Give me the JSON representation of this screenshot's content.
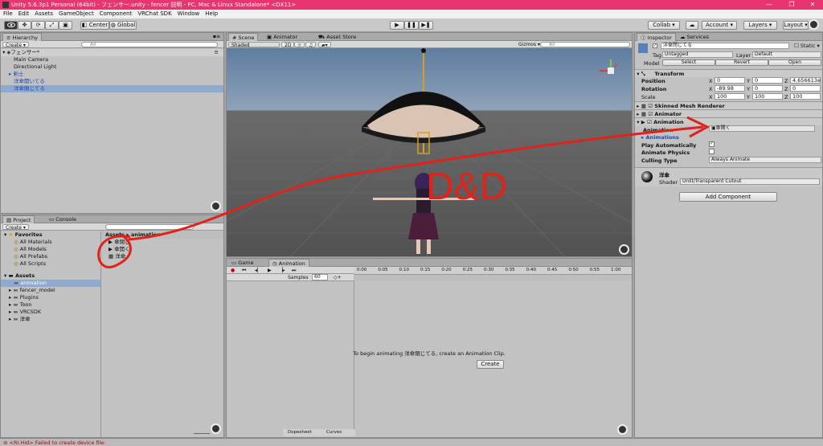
{
  "window": {
    "title": "Unity 5.6.3p1 Personal (64bit) - フェンサー.unity - fencer 説明 - PC, Mac & Linux Standalone* <DX11>",
    "controls": [
      "—",
      "❐",
      "✕"
    ]
  },
  "menu": [
    "File",
    "Edit",
    "Assets",
    "GameObject",
    "Component",
    "VRChat SDK",
    "Window",
    "Help"
  ],
  "toolbar": {
    "center": "Center",
    "global": "Global",
    "collab": "Collab ▾",
    "account": "Account ▾",
    "layers": "Layers ▾",
    "layout": "Layout ▾"
  },
  "hierarchy": {
    "tab": "Hierarchy",
    "create": "Create ▾",
    "search_placeholder": "All",
    "scene": "フェンサー*",
    "items": [
      "Main Camera",
      "Directional Light",
      "剣士",
      "洋傘開いてる",
      "洋傘閉じてる"
    ]
  },
  "scene": {
    "tabs": [
      "Scene",
      "Animator",
      "Asset Store"
    ],
    "shading": "Shaded",
    "mode2d": "2D",
    "gizmos": "Gizmos ▾",
    "search_placeholder": "All",
    "annotation": "D&D"
  },
  "project": {
    "tabs": [
      "Project",
      "Console"
    ],
    "create": "Create ▾",
    "favorites_label": "Favorites",
    "favorites": [
      "All Materials",
      "All Models",
      "All Prefabs",
      "All Scripts"
    ],
    "assets_label": "Assets",
    "assets": [
      "animation",
      "fencer_model",
      "Plugins",
      "Toon",
      "VRCSDK",
      "洋傘"
    ],
    "breadcrumb": "Assets ▸ animation",
    "files": [
      "傘閉じ",
      "傘開く",
      "洋傘"
    ]
  },
  "animation": {
    "tabs": [
      "Game",
      "Animation"
    ],
    "samples_label": "Samples",
    "samples": "60",
    "ruler": [
      "0:00",
      "0:05",
      "0:10",
      "0:15",
      "0:20",
      "0:25",
      "0:30",
      "0:35",
      "0:40",
      "0:45",
      "0:50",
      "0:55",
      "1:00"
    ],
    "message": "To begin animating 洋傘閉じてる, create an Animation Clip.",
    "create_button": "Create",
    "bottom_tabs": [
      "Dopesheet",
      "Curves"
    ]
  },
  "inspector": {
    "tabs": [
      "Inspector",
      "Services"
    ],
    "object_name": "洋傘閉じてる",
    "static": "Static ▾",
    "tag_label": "Tag",
    "tag": "Untagged",
    "layer_label": "Layer",
    "layer": "Default",
    "model_label": "Model",
    "model_buttons": [
      "Select",
      "Revert",
      "Open"
    ],
    "transform": {
      "title": "Transform",
      "rows": [
        {
          "label": "Position",
          "x": "0",
          "y": "0",
          "z": "4.656613e"
        },
        {
          "label": "Rotation",
          "x": "-89.98",
          "y": "0",
          "z": "0"
        },
        {
          "label": "Scale",
          "x": "100",
          "y": "100",
          "z": "100"
        }
      ]
    },
    "components": [
      "Skinned Mesh Renderer",
      "Animator",
      "Animation"
    ],
    "animation_field_label": "Animation",
    "animation_value": "傘開く",
    "animations_label": "Animations",
    "play_automatically": "Play Automatically",
    "animate_physics": "Animate Physics",
    "culling_type_label": "Culling Type",
    "culling_type": "Always Animate",
    "material": "洋傘",
    "shader_label": "Shader",
    "shader": "Unlit/Transparent Cutout",
    "add_component": "Add Component"
  },
  "status": {
    "message": "<RI.Hid> Failed to create device file:"
  },
  "colors": {
    "titlebar": "#e8346f",
    "selection": "#8fa9cf",
    "annotation_red": "#e0231a"
  }
}
